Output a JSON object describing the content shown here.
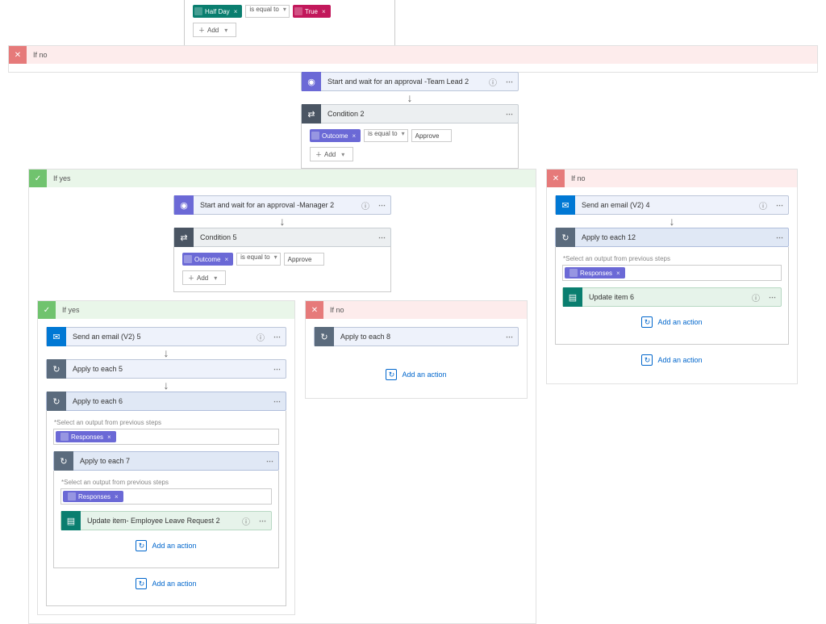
{
  "operators": {
    "is_equal_to": "is equal to"
  },
  "buttons": {
    "add": "Add",
    "add_action": "Add an action"
  },
  "labels": {
    "select_output": "*Select an output from previous steps"
  },
  "top_condition": {
    "left_token": "Half Day",
    "operator": "is equal to",
    "right_token": "True"
  },
  "ifno1": {
    "label": "If no"
  },
  "approval_teamlead2": {
    "title": "Start and wait for an approval -Team Lead 2"
  },
  "condition2": {
    "title": "Condition 2",
    "left_token": "Outcome",
    "operator": "is equal to",
    "value": "Approve"
  },
  "ifyes1": {
    "label": "If yes"
  },
  "approval_manager2": {
    "title": "Start and wait for an approval -Manager 2"
  },
  "condition5": {
    "title": "Condition 5",
    "left_token": "Outcome",
    "operator": "is equal to",
    "value": "Approve"
  },
  "ifyes2": {
    "label": "If yes"
  },
  "send_email_5": {
    "title": "Send an email (V2) 5"
  },
  "apply_each_5": {
    "title": "Apply to each 5"
  },
  "apply_each_6": {
    "title": "Apply to each 6",
    "responses": "Responses"
  },
  "apply_each_7": {
    "title": "Apply to each 7",
    "responses": "Responses"
  },
  "update_item_emp": {
    "title": "Update item- Employee Leave Request 2"
  },
  "ifno2": {
    "label": "If no"
  },
  "apply_each_8": {
    "title": "Apply to each 8"
  },
  "ifno_right": {
    "label": "If no"
  },
  "send_email_4": {
    "title": "Send an email (V2) 4"
  },
  "apply_each_12": {
    "title": "Apply to each 12",
    "responses": "Responses"
  },
  "update_item_6": {
    "title": "Update item 6"
  }
}
